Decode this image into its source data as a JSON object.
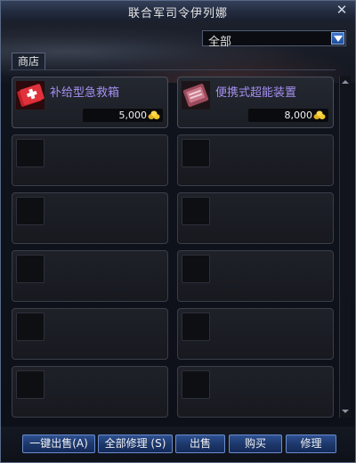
{
  "window": {
    "title": "联合军司令伊列娜"
  },
  "filter": {
    "selected": "全部"
  },
  "tabs": [
    {
      "label": "商店"
    }
  ],
  "items": [
    {
      "name": "补给型急救箱",
      "price": "5,000",
      "icon": "first-aid-kit-icon"
    },
    {
      "name": "便携式超能装置",
      "price": "8,000",
      "icon": "portable-device-icon"
    }
  ],
  "buttons": {
    "sell_all": "一键出售(A)",
    "repair_all": "全部修理 (S)",
    "sell": "出售",
    "buy": "购买",
    "repair": "修理"
  },
  "colors": {
    "item_name": "#a48ff0",
    "button": "#1c3769"
  }
}
